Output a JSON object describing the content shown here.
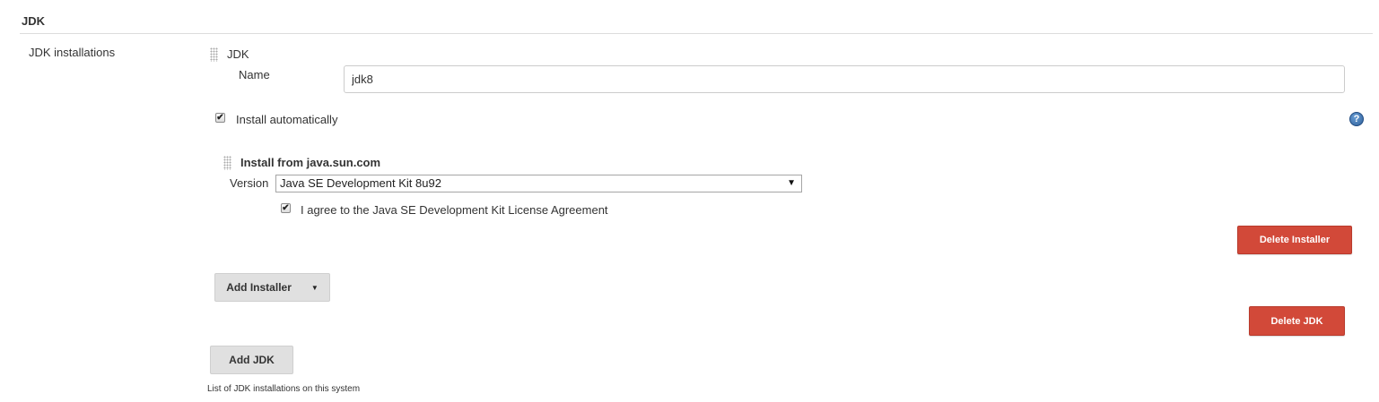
{
  "section": {
    "title": "JDK"
  },
  "field": {
    "label": "JDK installations",
    "description": "List of JDK installations on this system"
  },
  "jdk": {
    "block_title": "JDK",
    "name_label": "Name",
    "name_value": "jdk8",
    "install_auto_label": "Install automatically",
    "install_auto_checked": true,
    "delete_label": "Delete JDK"
  },
  "installer": {
    "title": "Install from java.sun.com",
    "version_label": "Version",
    "version_value": "Java SE Development Kit 8u92",
    "agree_label": "I agree to the Java SE Development Kit License Agreement",
    "agree_checked": true,
    "delete_label": "Delete Installer",
    "add_label": "Add Installer"
  },
  "add_jdk_label": "Add JDK",
  "help": {
    "glyph": "?",
    "icon": "help-icon"
  },
  "icons": {
    "check": "✔",
    "dropdown": "▼"
  },
  "colors": {
    "danger": "#d24939",
    "button_grey": "#e0e0e0",
    "help_blue": "#2e5f99"
  }
}
